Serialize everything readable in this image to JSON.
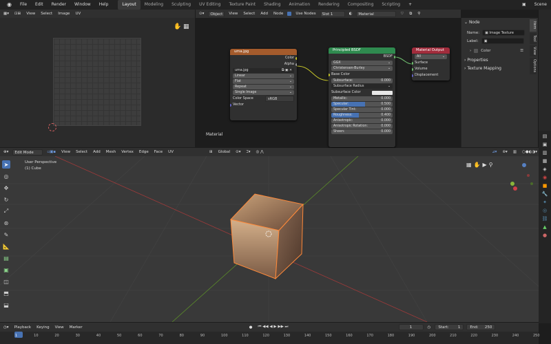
{
  "topbar": {
    "menus": [
      "File",
      "Edit",
      "Render",
      "Window",
      "Help"
    ],
    "workspaces": [
      "Layout",
      "Modeling",
      "Sculpting",
      "UV Editing",
      "Texture Paint",
      "Shading",
      "Animation",
      "Rendering",
      "Compositing",
      "Scripting"
    ],
    "active_workspace": "Layout",
    "scene_label": "Scene"
  },
  "uv_editor": {
    "menus": [
      "View",
      "Select",
      "Image",
      "UV"
    ]
  },
  "node_editor": {
    "mode": "Object",
    "menus": [
      "View",
      "Select",
      "Add",
      "Node"
    ],
    "use_nodes_label": "Use Nodes",
    "slot": "Slot 1",
    "material": "Material",
    "footer_label": "Material",
    "image_node": {
      "title": "uma.jpg",
      "outputs": [
        "Color",
        "Alpha"
      ],
      "image_name": "uma.jpg",
      "interpolation": "Linear",
      "projection": "Flat",
      "extension": "Repeat",
      "source": "Single Image",
      "color_space_label": "Color Space",
      "color_space": "sRGB",
      "vector_label": "Vector"
    },
    "bsdf_node": {
      "title": "Principled BSDF",
      "output": "BSDF",
      "distribution": "GGX",
      "subsurface_method": "Christensen-Burley",
      "base_color": "Base Color",
      "rows": [
        {
          "label": "Subsurface:",
          "value": "0.000"
        },
        {
          "label": "Subsurface Radius",
          "value": ""
        },
        {
          "label": "Subsurface Color",
          "value": ""
        },
        {
          "label": "Metallic:",
          "value": "0.000"
        },
        {
          "label": "Specular:",
          "value": "0.500"
        },
        {
          "label": "Specular Tint:",
          "value": "0.000"
        },
        {
          "label": "Roughness:",
          "value": "0.400"
        },
        {
          "label": "Anisotropic:",
          "value": "0.000"
        },
        {
          "label": "Anisotropic Rotation:",
          "value": "0.000"
        },
        {
          "label": "Sheen:",
          "value": "0.000"
        }
      ]
    },
    "output_node": {
      "title": "Material Output",
      "target": "All",
      "inputs": [
        "Surface",
        "Volume",
        "Displacement"
      ]
    }
  },
  "sidebar": {
    "section_node": "Node",
    "name_label": "Name:",
    "name_value": "Image Texture",
    "label_label": "Label:",
    "color_label": "Color",
    "properties_label": "Properties",
    "texture_mapping_label": "Texture Mapping",
    "tabs": [
      "Item",
      "Tool",
      "View",
      "Options"
    ]
  },
  "viewport": {
    "mode": "Edit Mode",
    "menus": [
      "View",
      "Select",
      "Add",
      "Mesh",
      "Vertex",
      "Edge",
      "Face",
      "UV"
    ],
    "transform": "Global",
    "overlay_title": "User Perspective",
    "overlay_object": "(1) Cube"
  },
  "timeline": {
    "menus": [
      "Playback",
      "Keying",
      "View",
      "Marker"
    ],
    "current_frame": "1",
    "start_label": "Start:",
    "start": "1",
    "end_label": "End:",
    "end": "250",
    "ticks": [
      "1",
      "10",
      "20",
      "30",
      "40",
      "50",
      "60",
      "70",
      "80",
      "90",
      "100",
      "110",
      "120",
      "130",
      "140",
      "150",
      "160",
      "170",
      "180",
      "190",
      "200",
      "210",
      "220",
      "230",
      "240",
      "250"
    ]
  }
}
